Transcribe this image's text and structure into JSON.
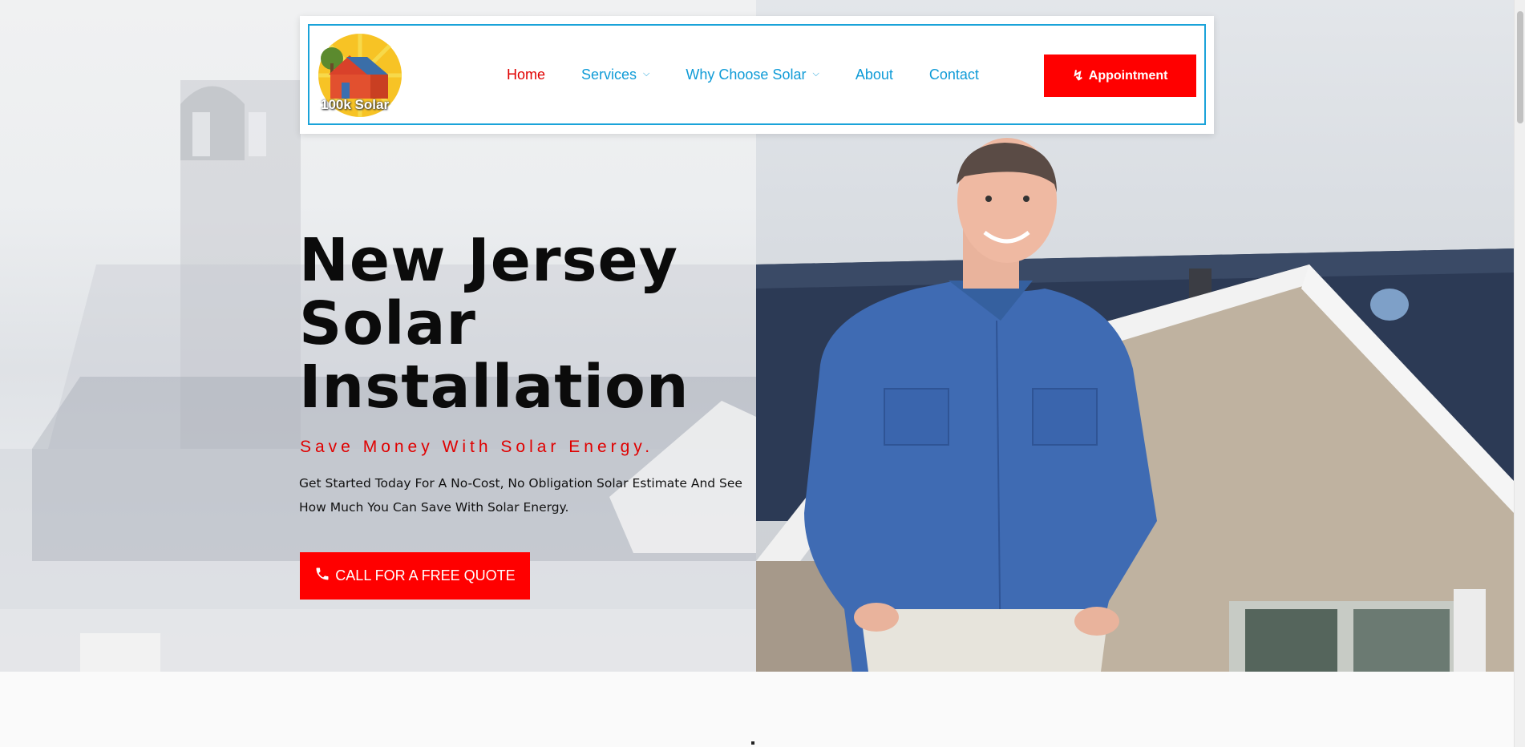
{
  "brand": {
    "logo_text": "100k Solar",
    "colors": {
      "accent": "#ff0000",
      "nav": "#0f9bd7",
      "nav_active": "#e00000",
      "border": "#1aa3d9",
      "title": "#0b0b0b"
    }
  },
  "nav": {
    "items": [
      {
        "label": "Home",
        "active": true,
        "dropdown": false
      },
      {
        "label": "Services",
        "active": false,
        "dropdown": true
      },
      {
        "label": "Why Choose Solar",
        "active": false,
        "dropdown": true
      },
      {
        "label": "About",
        "active": false,
        "dropdown": false
      },
      {
        "label": "Contact",
        "active": false,
        "dropdown": false
      }
    ],
    "appointment_label": "Appointment",
    "appointment_icon": "bolt-icon",
    "dropdown_icon": "chevron-down-icon"
  },
  "hero": {
    "title_line1": "New Jersey",
    "title_line2": "Solar",
    "title_line3": "Installation",
    "tagline": "Save Money With Solar Energy.",
    "lead": "Get Started Today For A No-Cost, No Obligation Solar Estimate And See How Much You Can Save With Solar Energy.",
    "cta_label": "CALL FOR A FREE QUOTE",
    "cta_icon": "phone-icon"
  }
}
